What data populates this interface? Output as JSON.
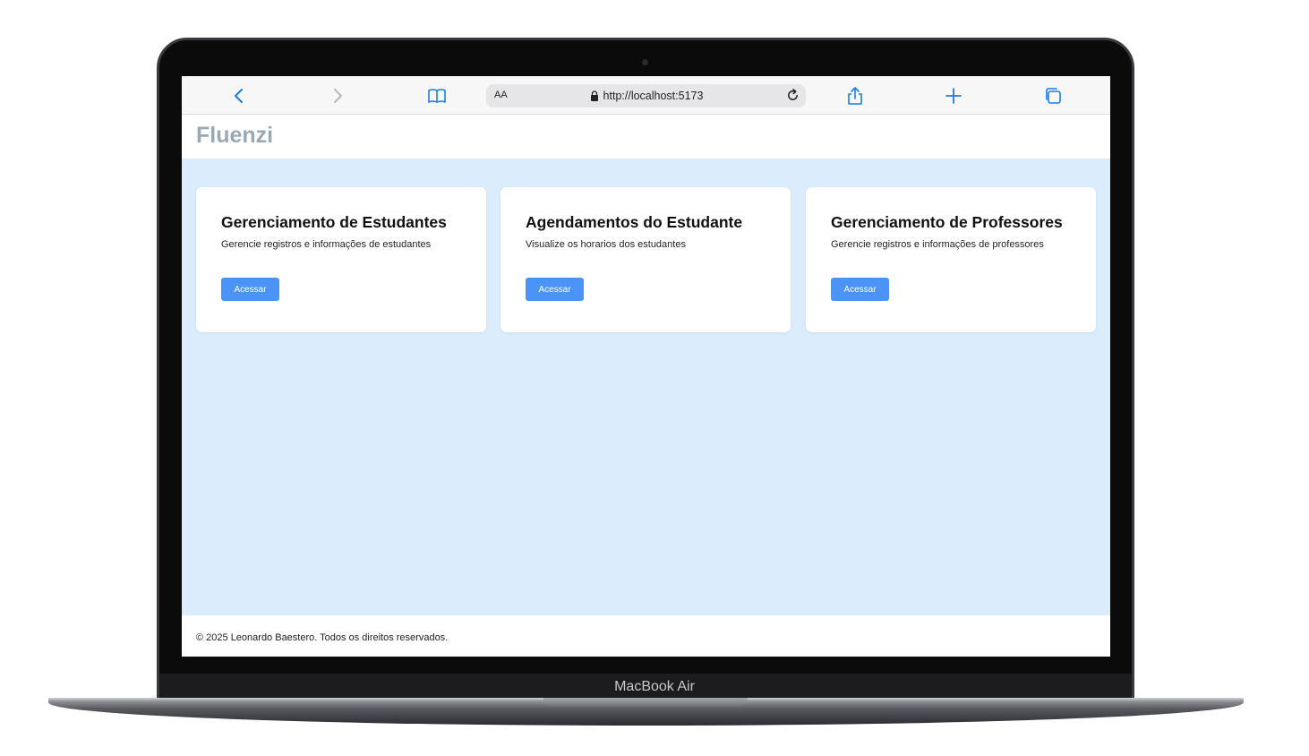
{
  "device": {
    "label": "MacBook Air"
  },
  "browser": {
    "text_size_label": "AA",
    "url": "http://localhost:5173",
    "icons": [
      "back-icon",
      "forward-icon",
      "bookmarks-icon",
      "lock-icon",
      "reload-icon",
      "share-icon",
      "new-tab-icon",
      "tabs-icon"
    ],
    "accent": "#1a7cf0"
  },
  "header": {
    "brand": "Fluenzi",
    "brand_color": "#9aa8b4"
  },
  "main": {
    "background": "#dbedfd",
    "cards": [
      {
        "title": "Gerenciamento de Estudantes",
        "description": "Gerencie registros e informações de estudantes",
        "button": "Acessar"
      },
      {
        "title": "Agendamentos do Estudante",
        "description": "Visualize os horarios dos estudantes",
        "button": "Acessar"
      },
      {
        "title": "Gerenciamento de Professores",
        "description": "Gerencie registros e informações de professores",
        "button": "Acessar"
      }
    ],
    "button_color": "#4b94f6"
  },
  "footer": {
    "text": "© 2025 Leonardo Baestero. Todos os direitos reservados."
  }
}
